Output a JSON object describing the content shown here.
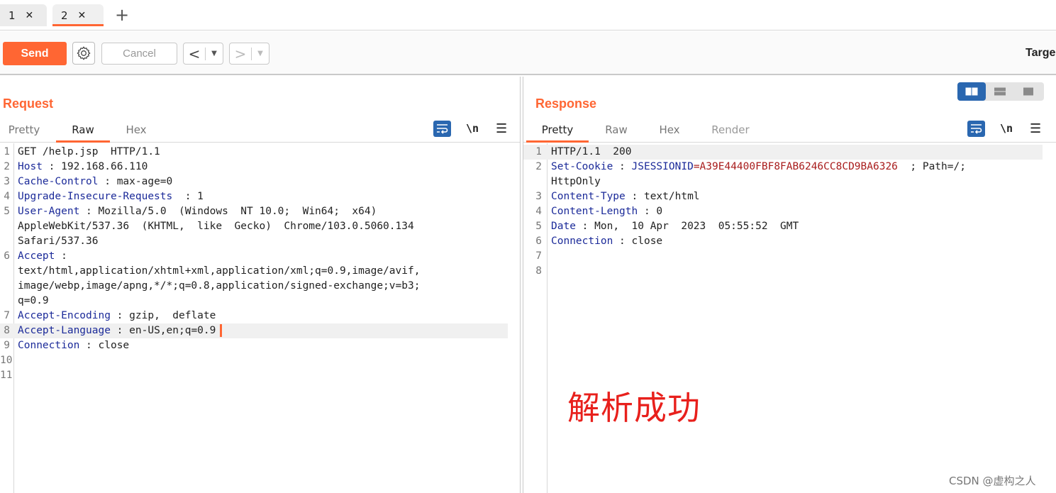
{
  "tabs": [
    {
      "label": "1"
    },
    {
      "label": "2",
      "active": true
    }
  ],
  "toolbar": {
    "send_label": "Send",
    "cancel_label": "Cancel",
    "target_label": "Targe"
  },
  "request": {
    "title": "Request",
    "subtabs": [
      "Pretty",
      "Raw",
      "Hex"
    ],
    "active_subtab": "Raw",
    "lines": [
      {
        "n": "1",
        "text": "GET /help.jsp  HTTP/1.1"
      },
      {
        "n": "2",
        "name": "Host",
        "sep": " : ",
        "value": "192.168.66.110"
      },
      {
        "n": "3",
        "name": "Cache-Control",
        "sep": " : ",
        "value": "max-age=0"
      },
      {
        "n": "4",
        "name": "Upgrade-Insecure-Requests",
        "sep": "  : ",
        "value": "1"
      },
      {
        "n": "5",
        "name": "User-Agent",
        "sep": " : ",
        "value": "Mozilla/5.0  (Windows  NT 10.0;  Win64;  x64)"
      },
      {
        "n": "",
        "text": "AppleWebKit/537.36  (KHTML,  like  Gecko)  Chrome/103.0.5060.134"
      },
      {
        "n": "",
        "text": "Safari/537.36"
      },
      {
        "n": "6",
        "name": "Accept",
        "sep": " :",
        "value": ""
      },
      {
        "n": "",
        "text": "text/html,application/xhtml+xml,application/xml;q=0.9,image/avif,"
      },
      {
        "n": "",
        "text": "image/webp,image/apng,*/*;q=0.8,application/signed-exchange;v=b3;"
      },
      {
        "n": "",
        "text": "q=0.9"
      },
      {
        "n": "7",
        "name": "Accept-Encoding",
        "sep": " : ",
        "value": "gzip,  deflate"
      },
      {
        "n": "8",
        "name": "Accept-Language",
        "sep": " : ",
        "value": "en-US,en;q=0.9",
        "highlight": true
      },
      {
        "n": "9",
        "name": "Connection",
        "sep": " : ",
        "value": "close"
      },
      {
        "n": "10",
        "text": ""
      },
      {
        "n": "11",
        "text": ""
      }
    ]
  },
  "response": {
    "title": "Response",
    "subtabs": [
      "Pretty",
      "Raw",
      "Hex",
      "Render"
    ],
    "active_subtab": "Pretty",
    "lines": [
      {
        "n": "1",
        "text": "HTTP/1.1  200",
        "highlight": true
      },
      {
        "n": "2",
        "name": "Set-Cookie",
        "sep": " : ",
        "cookie_name": "JSESSIONID",
        "cookie_value": "=A39E44400FBF8FAB6246CC8CD9BA6326",
        "rest": "  ; Path=/;"
      },
      {
        "n": "",
        "text": "HttpOnly"
      },
      {
        "n": "3",
        "name": "Content-Type",
        "sep": " : ",
        "value": "text/html"
      },
      {
        "n": "4",
        "name": "Content-Length",
        "sep": " : ",
        "value": "0"
      },
      {
        "n": "5",
        "name": "Date",
        "sep": " : ",
        "value": "Mon,  10 Apr  2023  05:55:52  GMT"
      },
      {
        "n": "6",
        "name": "Connection",
        "sep": " : ",
        "value": "close"
      },
      {
        "n": "7",
        "text": ""
      },
      {
        "n": "8",
        "text": ""
      }
    ]
  },
  "annotation": "解析成功",
  "watermark": "CSDN @虚构之人",
  "colors": {
    "accent": "#ff6633",
    "header_name": "#1b2a99",
    "cookie_value": "#a81c1c",
    "toggle_active": "#2a67b0",
    "annotation": "#e8201c"
  }
}
